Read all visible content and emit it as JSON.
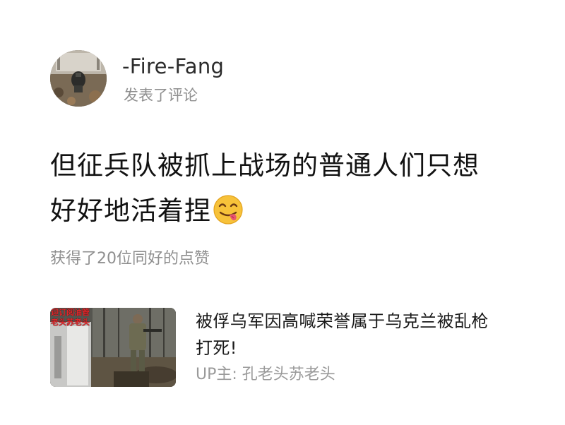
{
  "header": {
    "username": "-Fire-Fang",
    "action_text": "发表了评论"
  },
  "comment": {
    "line1": "但征兵队被抓上战场的普通人们只想",
    "line2": "好好地活着捏",
    "emoji": "savoring-food-face-icon"
  },
  "likes_text": "获得了20位同好的点赞",
  "video_card": {
    "title_line1": "被俘乌军因高喊荣誉属于乌克兰被乱枪",
    "title_line2": "打死!",
    "uploader": "UP主:  孔老头苏老头",
    "thumbnail": {
      "caption_line1": "迎订阅油管",
      "caption_line2": "老头苏老头"
    }
  },
  "colors": {
    "primary_text": "#121212",
    "secondary_text": "#8f8f8f",
    "thumb_caption": "#e3262a",
    "emoji_face": "#f7c23a"
  }
}
